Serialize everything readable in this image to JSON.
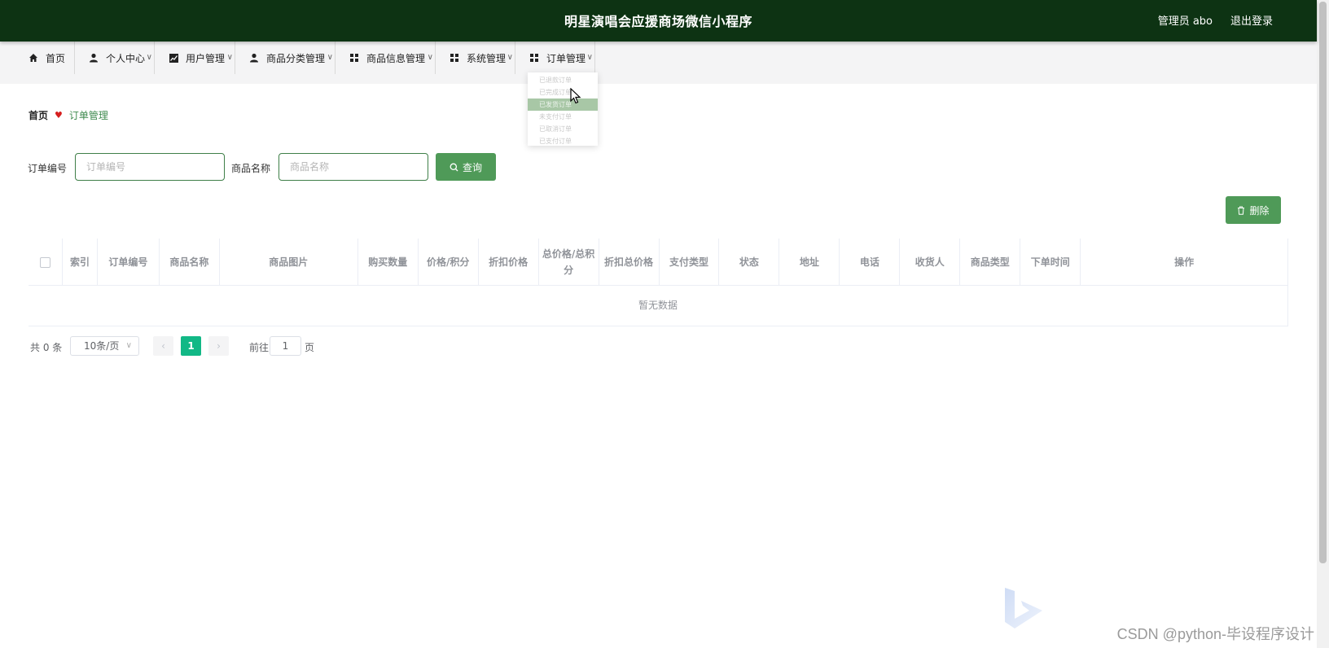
{
  "header": {
    "title": "明星演唱会应援商场微信小程序",
    "user_label": "管理员 abo",
    "logout_label": "退出登录",
    "bg_color": "#0d3313"
  },
  "nav": {
    "items": [
      {
        "label": "首页",
        "icon": "home-icon"
      },
      {
        "label": "个人中心",
        "icon": "user-icon"
      },
      {
        "label": "用户管理",
        "icon": "chart-icon"
      },
      {
        "label": "商品分类管理",
        "icon": "user-icon"
      },
      {
        "label": "商品信息管理",
        "icon": "grid-icon"
      },
      {
        "label": "系统管理",
        "icon": "grid-icon"
      },
      {
        "label": "订单管理",
        "icon": "grid-icon"
      }
    ]
  },
  "dropdown": {
    "items": [
      "已退款订单",
      "已完成订单",
      "已发货订单",
      "未支付订单",
      "已取消订单",
      "已支付订单"
    ],
    "active_index": 2
  },
  "breadcrumb": {
    "home": "首页",
    "current": "订单管理"
  },
  "search": {
    "order_no_label": "订单编号",
    "order_no_placeholder": "订单编号",
    "product_name_label": "商品名称",
    "product_name_placeholder": "商品名称",
    "query_label": "查询"
  },
  "toolbar": {
    "delete_label": "删除"
  },
  "table": {
    "columns": [
      "索引",
      "订单编号",
      "商品名称",
      "商品图片",
      "购买数量",
      "价格/积分",
      "折扣价格",
      "总价格/总积分",
      "折扣总价格",
      "支付类型",
      "状态",
      "地址",
      "电话",
      "收货人",
      "商品类型",
      "下单时间",
      "操作"
    ],
    "empty_text": "暂无数据"
  },
  "pagination": {
    "total_label": "共 0 条",
    "page_size_label": "10条/页",
    "current_page": "1",
    "goto_label": "前往",
    "goto_value": "1",
    "page_suffix": "页",
    "active_color": "#12b886"
  },
  "watermark": "CSDN @python-毕设程序设计"
}
